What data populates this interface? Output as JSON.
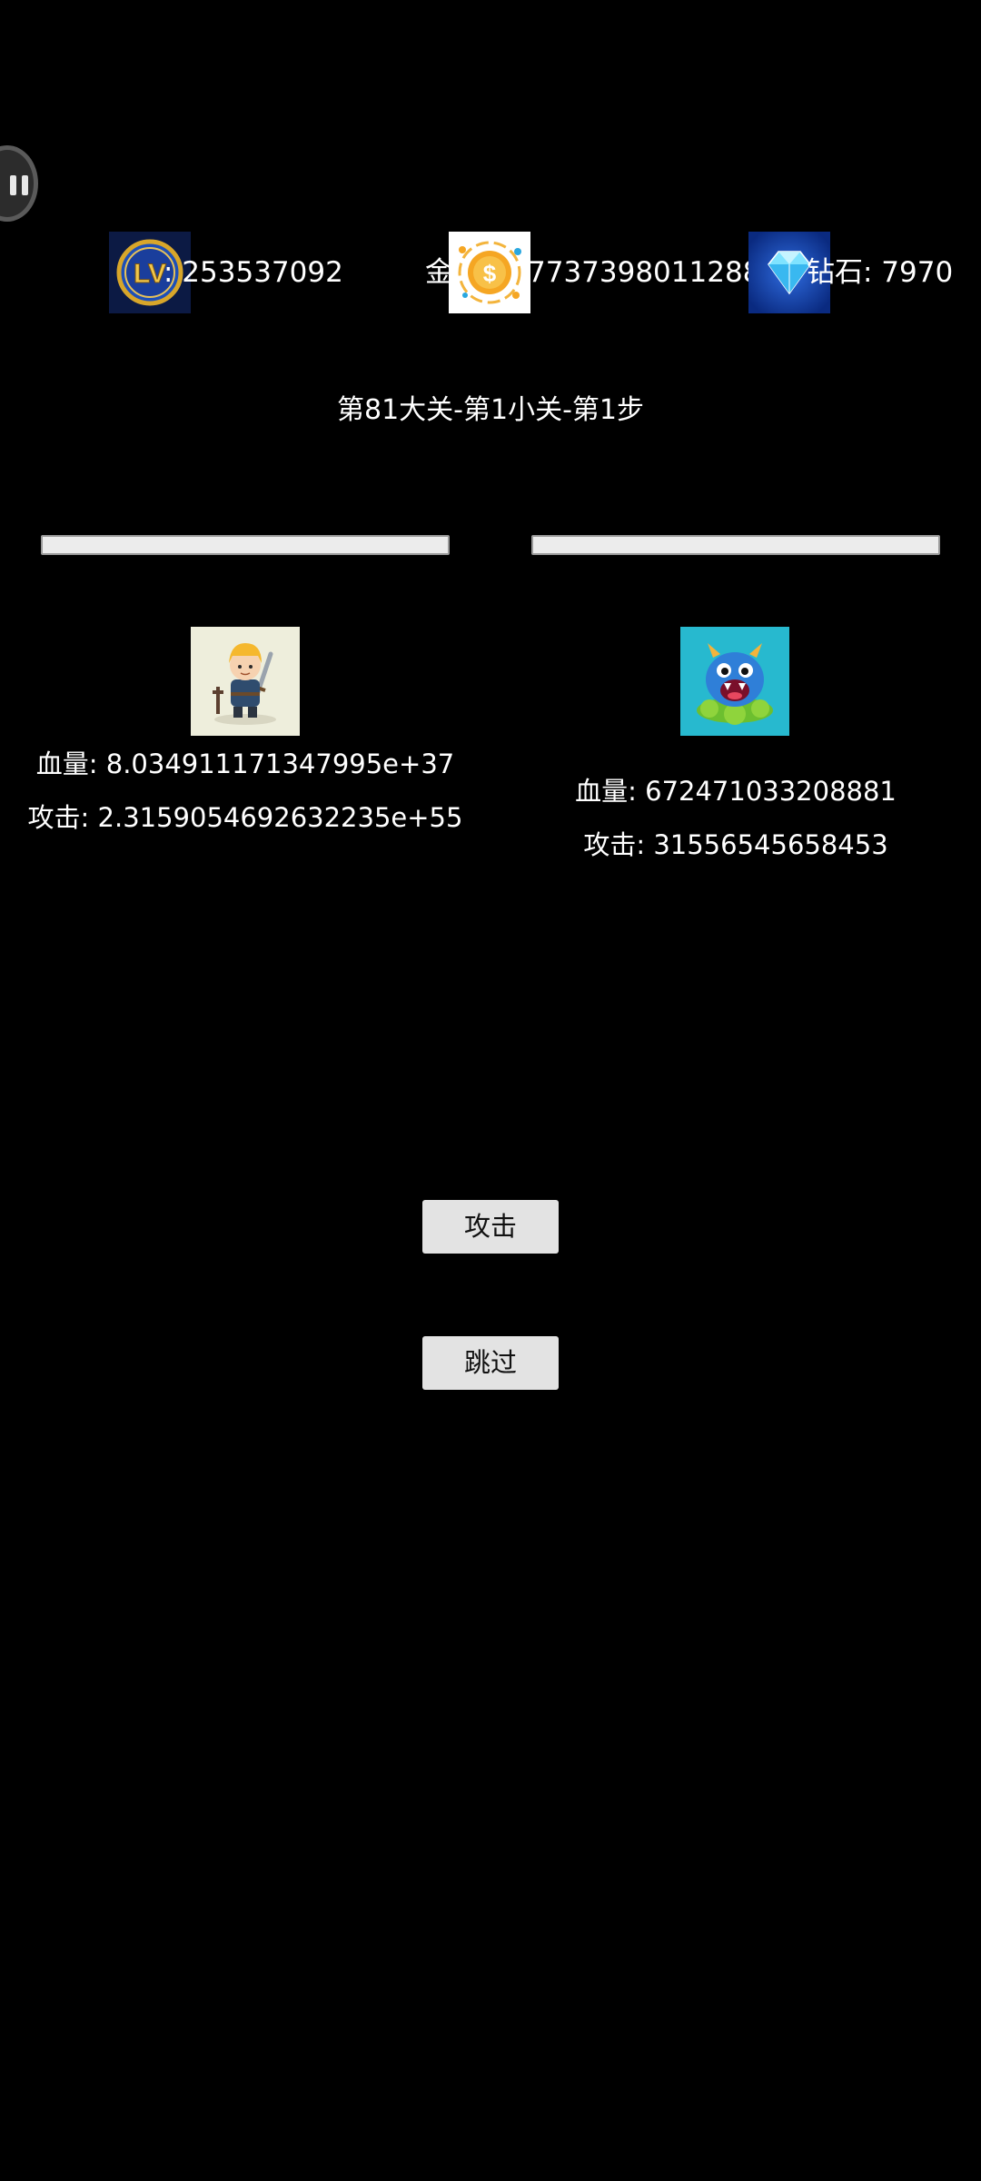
{
  "stats": {
    "lv_icon_text": "LV",
    "level_text": ": 253537092",
    "gold_label": "金",
    "gold_icon_text": "$",
    "gold_value": "7737398011288",
    "diamond_label": "钻石",
    "diamond_text": "钻石: 7970"
  },
  "stage_title": "第81大关-第1小关-第1步",
  "player": {
    "hp_text": "血量: 8.034911171347995e+37",
    "attack_text": "攻击: 2.3159054692632235e+55",
    "hp_fraction": 1.0
  },
  "enemy": {
    "hp_text": "血量: 672471033208881",
    "attack_text": "攻击: 31556545658453",
    "hp_fraction": 1.0
  },
  "buttons": {
    "attack": "攻击",
    "skip": "跳过"
  },
  "colors": {
    "background": "#000000",
    "button_bg": "#e3e3e3",
    "hp_bar": "#ececec",
    "enemy_portrait_bg": "#27b9cf"
  }
}
